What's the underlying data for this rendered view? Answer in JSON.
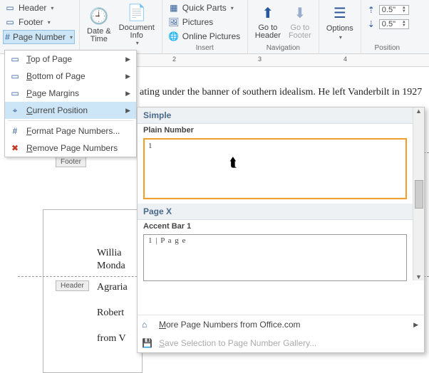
{
  "ribbon": {
    "headerFooter": {
      "header": "Header",
      "footer": "Footer",
      "pageNumber": "Page Number"
    },
    "dateTime": {
      "label": "Date &\nTime"
    },
    "docInfo": {
      "label": "Document\nInfo"
    },
    "insertGroup": {
      "quickParts": "Quick Parts",
      "pictures": "Pictures",
      "onlinePictures": "Online Pictures",
      "label": "Insert"
    },
    "nav": {
      "gotoHeader": "Go to\nHeader",
      "gotoFooter": "Go to\nFooter",
      "label": "Navigation"
    },
    "options": {
      "label": "Options"
    },
    "position": {
      "top": "0.5\"",
      "bottom": "0.5\"",
      "label": "Position"
    }
  },
  "ruler": {
    "marks": [
      "2",
      "3",
      "4"
    ]
  },
  "menu": {
    "top": "Top of Page",
    "bottom": "Bottom of Page",
    "margins": "Page Margins",
    "current": "Current Position",
    "format": "Format Page Numbers...",
    "remove": "Remove Page Numbers"
  },
  "gallery": {
    "cat1": "Simple",
    "item1": "Plain Number",
    "cat2": "Page X",
    "item2": "Accent Bar 1",
    "preview2": "1 | P a g e",
    "more": "More Page Numbers from Office.com",
    "save": "Save Selection to Page Number Gallery..."
  },
  "doc": {
    "line1": "ating under the banner of southern idealism.  He left Vanderbilt in 1927",
    "footerTag": "Footer",
    "nameLine": "Willia",
    "dayLine": "Monda",
    "headerTag": "Header",
    "agrarian": "Agraria",
    "robert": "Robert",
    "fromV": "from V"
  }
}
